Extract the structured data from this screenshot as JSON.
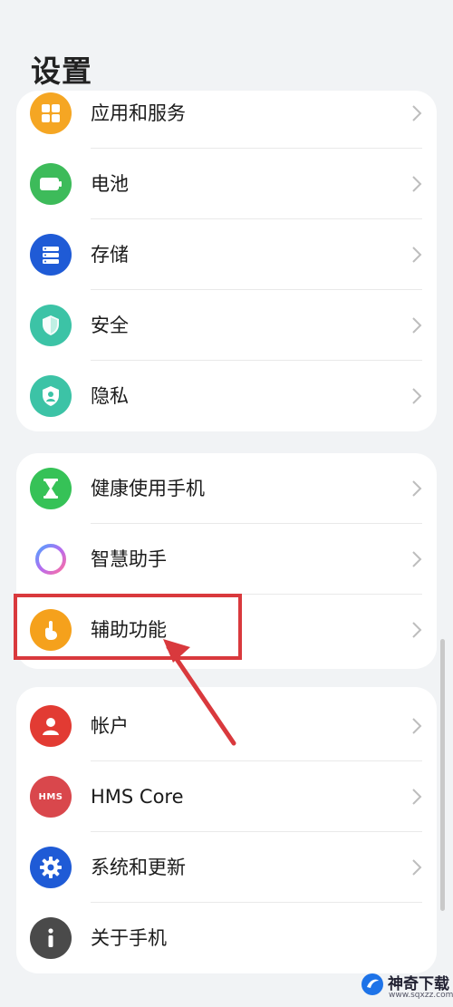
{
  "page": {
    "title": "设置"
  },
  "groups": [
    {
      "items": [
        {
          "label": "应用和服务",
          "icon": "apps-icon",
          "color": "#f5a623"
        },
        {
          "label": "电池",
          "icon": "battery-icon",
          "color": "#3dbb5a"
        },
        {
          "label": "存储",
          "icon": "storage-icon",
          "color": "#1f5bd6"
        },
        {
          "label": "安全",
          "icon": "shield-icon",
          "color": "#3cc3a6"
        },
        {
          "label": "隐私",
          "icon": "privacy-icon",
          "color": "#3cc3a6"
        }
      ]
    },
    {
      "items": [
        {
          "label": "健康使用手机",
          "icon": "hourglass-icon",
          "color": "#36c257"
        },
        {
          "label": "智慧助手",
          "icon": "assistant-ring-icon",
          "color": "#9b6cf0"
        },
        {
          "label": "辅助功能",
          "icon": "accessibility-hand-icon",
          "color": "#f5a11c"
        }
      ]
    },
    {
      "items": [
        {
          "label": "帐户",
          "icon": "account-icon",
          "color": "#e23b33"
        },
        {
          "label": "HMS Core",
          "icon": "hms-icon",
          "color": "#d9474c",
          "icon_text": "HMS"
        },
        {
          "label": "系统和更新",
          "icon": "gear-icon",
          "color": "#1f5bd6"
        },
        {
          "label": "关于手机",
          "icon": "info-icon",
          "color": "#4a4a4a"
        }
      ]
    }
  ],
  "annotation": {
    "color": "#d9393d",
    "highlighted_item": "辅助功能"
  },
  "watermark": {
    "text": "神奇下载",
    "url": "www.sqxzz.com"
  }
}
